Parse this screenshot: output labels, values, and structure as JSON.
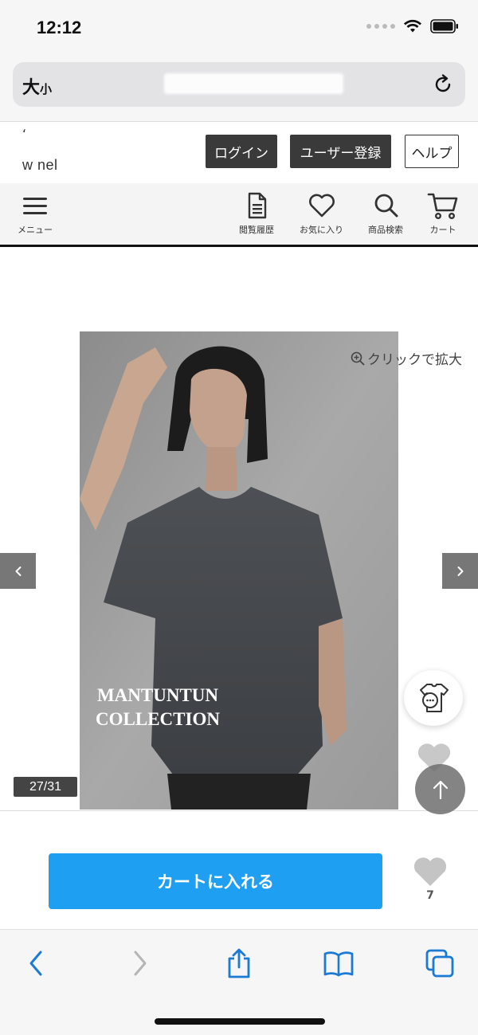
{
  "status_bar": {
    "time": "12:12"
  },
  "url_bar": {
    "text_size_label_big": "大",
    "text_size_label_small": "小"
  },
  "header": {
    "logo_mark": "ʻ",
    "logo_text": "w         nel",
    "login_label": "ログイン",
    "register_label": "ユーザー登録",
    "help_label": "ヘルプ"
  },
  "nav": {
    "menu_label": "メニュー",
    "history_label": "閲覧履歴",
    "favorites_label": "お気に入り",
    "search_label": "商品検索",
    "cart_label": "カート"
  },
  "gallery": {
    "zoom_hint": "クリックで拡大",
    "counter": "27/31",
    "brand_line1": "MANTUNTUN",
    "brand_line2": "COLLECTION"
  },
  "actions": {
    "add_to_cart_label": "カートに入れる",
    "favorite_count": "7"
  },
  "colors": {
    "accent": "#1e9ff2",
    "header_button": "#3a3a3a",
    "ios_blue": "#1a7ad4"
  }
}
